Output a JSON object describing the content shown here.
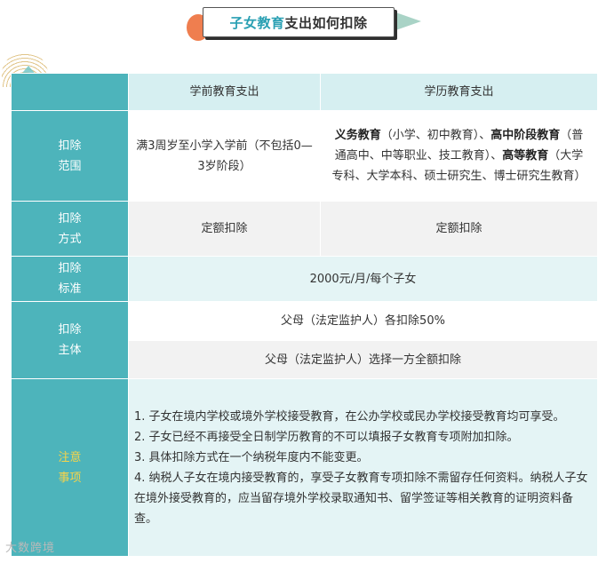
{
  "title": {
    "accent": "子女教育",
    "rest": "支出如何扣除"
  },
  "table": {
    "headers": {
      "preschool": "学前教育支出",
      "academic": "学历教育支出"
    },
    "rows": {
      "scope": {
        "label_1": "扣除",
        "label_2": "范围",
        "preschool": "满3周岁至小学入学前（不包括0—3岁阶段）",
        "academic": {
          "part1_bold": "义务教育",
          "part1": "（小学、初中教育）、",
          "part2_bold": "高中阶段教育",
          "part2": "（普通高中、中等职业、技工教育）、",
          "part3_bold": "高等教育",
          "part3": "（大学专科、大学本科、硕士研究生、博士研究生教育）"
        }
      },
      "method": {
        "label_1": "扣除",
        "label_2": "方式",
        "preschool": "定额扣除",
        "academic": "定额扣除"
      },
      "standard": {
        "label_1": "扣除",
        "label_2": "标准",
        "value": "2000元/月/每个子女"
      },
      "subject": {
        "label_1": "扣除",
        "label_2": "主体",
        "option_1": "父母（法定监护人）各扣除50%",
        "option_2": "父母（法定监护人）选择一方全额扣除"
      },
      "notes": {
        "label_1": "注意",
        "label_2": "事项",
        "items": [
          "1. 子女在境内学校或境外学校接受教育，在公办学校或民办学校接受教育均可享受。",
          "2. 子女已经不再接受全日制学历教育的不可以填报子女教育专项附加扣除。",
          "3. 具体扣除方式在一个纳税年度内不能变更。",
          "4. 纳税人子女在境内接受教育的，享受子女教育专项扣除不需留存任何资料。纳税人子女在境外接受教育的，应当留存境外学校录取通知书、留学签证等相关教育的证明资料备查。"
        ]
      }
    }
  },
  "watermark": "大数跨境",
  "colors": {
    "teal": "#4db4bb",
    "light_teal": "#d6eff1",
    "accent_title": "#2aa0b3",
    "note_label": "#f7d44a",
    "orange": "#ef7e4f"
  }
}
